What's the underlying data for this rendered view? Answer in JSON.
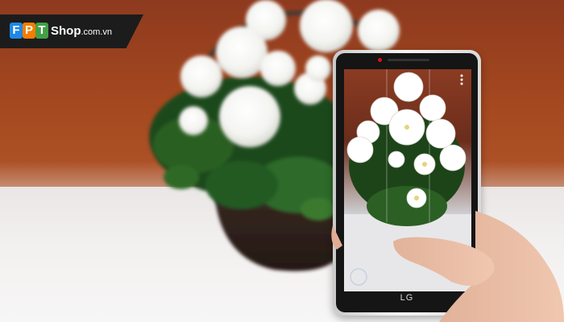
{
  "logo": {
    "part1": "F",
    "part2": "P",
    "part3": "T",
    "part4": "Shop",
    "suffix": ".com.vn"
  },
  "phone_brand": "LG",
  "colors": {
    "wall": "#a4481f",
    "table": "#f2f0ef",
    "logo_bg": "#1c1c1c",
    "fpt_blue": "#1e88e5",
    "fpt_orange": "#f57c00",
    "fpt_green": "#43a047"
  }
}
